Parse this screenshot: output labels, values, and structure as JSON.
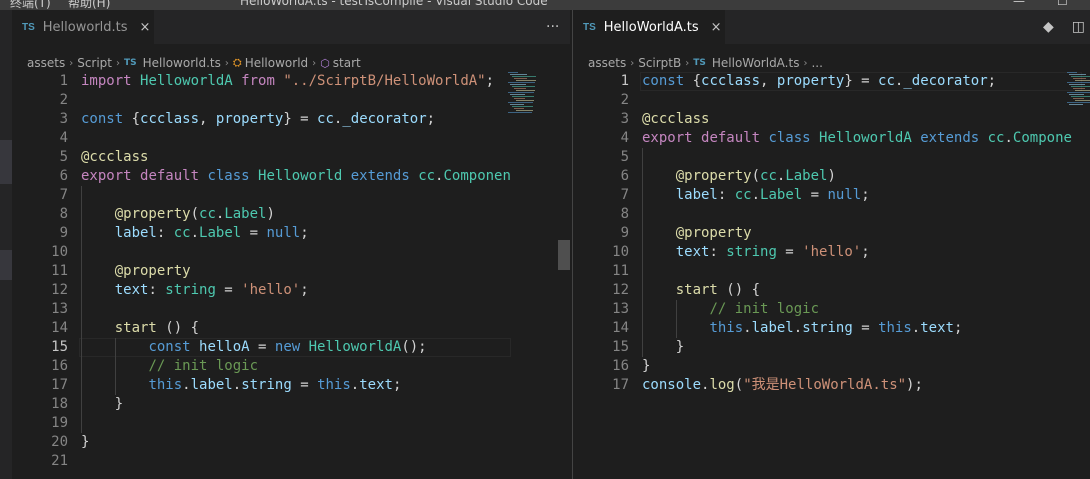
{
  "window": {
    "menu_terminal": "终端(T)",
    "menu_help": "帮助(H)",
    "title": "HelloWorldA.ts - testTsComplie - Visual Studio Code"
  },
  "colors": {
    "background": "#1e1e1e",
    "keyword": "#569cd6",
    "control": "#c586c0",
    "string": "#ce9178",
    "variable": "#9cdcfe",
    "type": "#4ec9b0",
    "function": "#dcdcaa",
    "comment": "#6a9955",
    "ts_badge": "#519aba"
  },
  "left": {
    "tab": {
      "badge": "TS",
      "label": "Helloworld.ts",
      "close": "×"
    },
    "more_actions": "···",
    "breadcrumb": [
      "assets",
      "Script",
      "Helloworld.ts",
      "Helloworld",
      "start"
    ],
    "current_line": 15,
    "lines": [
      [
        [
          "kw2",
          "import "
        ],
        [
          "cls",
          "HelloworldA"
        ],
        [
          "kw2",
          " from "
        ],
        [
          "str",
          "\"../ScirptB/HelloWorldA\""
        ],
        [
          "pl",
          ";"
        ]
      ],
      [],
      [
        [
          "kw",
          "const "
        ],
        [
          "pl",
          "{"
        ],
        [
          "var",
          "ccclass"
        ],
        [
          "pl",
          ", "
        ],
        [
          "var",
          "property"
        ],
        [
          "pl",
          "} = "
        ],
        [
          "var",
          "cc"
        ],
        [
          "pl",
          "."
        ],
        [
          "var",
          "_decorator"
        ],
        [
          "pl",
          ";"
        ]
      ],
      [],
      [
        [
          "fn",
          "@ccclass"
        ]
      ],
      [
        [
          "kw2",
          "export "
        ],
        [
          "kw2",
          "default "
        ],
        [
          "kw",
          "class "
        ],
        [
          "cls",
          "Helloworld "
        ],
        [
          "kw",
          "extends "
        ],
        [
          "cls",
          "cc"
        ],
        [
          "pl",
          "."
        ],
        [
          "cls",
          "Componen"
        ]
      ],
      [],
      [
        [
          "pl",
          "    "
        ],
        [
          "fn",
          "@property"
        ],
        [
          "pl",
          "("
        ],
        [
          "cls",
          "cc"
        ],
        [
          "pl",
          "."
        ],
        [
          "cls",
          "Label"
        ],
        [
          "pl",
          ")"
        ]
      ],
      [
        [
          "pl",
          "    "
        ],
        [
          "var",
          "label"
        ],
        [
          "pl",
          ": "
        ],
        [
          "cls",
          "cc"
        ],
        [
          "pl",
          "."
        ],
        [
          "cls",
          "Label"
        ],
        [
          "pl",
          " = "
        ],
        [
          "kw",
          "null"
        ],
        [
          "pl",
          ";"
        ]
      ],
      [],
      [
        [
          "pl",
          "    "
        ],
        [
          "fn",
          "@property"
        ]
      ],
      [
        [
          "pl",
          "    "
        ],
        [
          "var",
          "text"
        ],
        [
          "pl",
          ": "
        ],
        [
          "cls",
          "string"
        ],
        [
          "pl",
          " = "
        ],
        [
          "str",
          "'hello'"
        ],
        [
          "pl",
          ";"
        ]
      ],
      [],
      [
        [
          "pl",
          "    "
        ],
        [
          "fn",
          "start"
        ],
        [
          "pl",
          " () {"
        ]
      ],
      [
        [
          "pl",
          "        "
        ],
        [
          "kw",
          "const "
        ],
        [
          "var",
          "helloA"
        ],
        [
          "pl",
          " = "
        ],
        [
          "kw",
          "new "
        ],
        [
          "cls",
          "HelloworldA"
        ],
        [
          "pl",
          "();"
        ]
      ],
      [
        [
          "pl",
          "        "
        ],
        [
          "cm",
          "// init logic"
        ]
      ],
      [
        [
          "pl",
          "        "
        ],
        [
          "kw",
          "this"
        ],
        [
          "pl",
          "."
        ],
        [
          "var",
          "label"
        ],
        [
          "pl",
          "."
        ],
        [
          "var",
          "string"
        ],
        [
          "pl",
          " = "
        ],
        [
          "kw",
          "this"
        ],
        [
          "pl",
          "."
        ],
        [
          "var",
          "text"
        ],
        [
          "pl",
          ";"
        ]
      ],
      [
        [
          "pl",
          "    }"
        ]
      ],
      [],
      [
        [
          "pl",
          "}"
        ]
      ],
      []
    ]
  },
  "right": {
    "tab": {
      "badge": "TS",
      "label": "HelloWorldA.ts",
      "close": "×"
    },
    "breadcrumb": [
      "assets",
      "ScirptB",
      "HelloWorldA.ts",
      "..."
    ],
    "current_line": 1,
    "lines": [
      [
        [
          "kw",
          "const "
        ],
        [
          "pl",
          "{"
        ],
        [
          "var",
          "ccclass"
        ],
        [
          "pl",
          ", "
        ],
        [
          "var",
          "property"
        ],
        [
          "pl",
          "} = "
        ],
        [
          "var",
          "cc"
        ],
        [
          "pl",
          "."
        ],
        [
          "var",
          "_decorator"
        ],
        [
          "pl",
          ";"
        ]
      ],
      [],
      [
        [
          "fn",
          "@ccclass"
        ]
      ],
      [
        [
          "kw2",
          "export "
        ],
        [
          "kw2",
          "default "
        ],
        [
          "kw",
          "class "
        ],
        [
          "cls",
          "HelloworldA "
        ],
        [
          "kw",
          "extends "
        ],
        [
          "cls",
          "cc"
        ],
        [
          "pl",
          "."
        ],
        [
          "cls",
          "Compone"
        ]
      ],
      [],
      [
        [
          "pl",
          "    "
        ],
        [
          "fn",
          "@property"
        ],
        [
          "pl",
          "("
        ],
        [
          "cls",
          "cc"
        ],
        [
          "pl",
          "."
        ],
        [
          "cls",
          "Label"
        ],
        [
          "pl",
          ")"
        ]
      ],
      [
        [
          "pl",
          "    "
        ],
        [
          "var",
          "label"
        ],
        [
          "pl",
          ": "
        ],
        [
          "cls",
          "cc"
        ],
        [
          "pl",
          "."
        ],
        [
          "cls",
          "Label"
        ],
        [
          "pl",
          " = "
        ],
        [
          "kw",
          "null"
        ],
        [
          "pl",
          ";"
        ]
      ],
      [],
      [
        [
          "pl",
          "    "
        ],
        [
          "fn",
          "@property"
        ]
      ],
      [
        [
          "pl",
          "    "
        ],
        [
          "var",
          "text"
        ],
        [
          "pl",
          ": "
        ],
        [
          "cls",
          "string"
        ],
        [
          "pl",
          " = "
        ],
        [
          "str",
          "'hello'"
        ],
        [
          "pl",
          ";"
        ]
      ],
      [],
      [
        [
          "pl",
          "    "
        ],
        [
          "fn",
          "start"
        ],
        [
          "pl",
          " () {"
        ]
      ],
      [
        [
          "pl",
          "        "
        ],
        [
          "cm",
          "// init logic"
        ]
      ],
      [
        [
          "pl",
          "        "
        ],
        [
          "kw",
          "this"
        ],
        [
          "pl",
          "."
        ],
        [
          "var",
          "label"
        ],
        [
          "pl",
          "."
        ],
        [
          "var",
          "string"
        ],
        [
          "pl",
          " = "
        ],
        [
          "kw",
          "this"
        ],
        [
          "pl",
          "."
        ],
        [
          "var",
          "text"
        ],
        [
          "pl",
          ";"
        ]
      ],
      [
        [
          "pl",
          "    }"
        ]
      ],
      [
        [
          "pl",
          "}"
        ]
      ],
      [
        [
          "var",
          "console"
        ],
        [
          "pl",
          "."
        ],
        [
          "fn",
          "log"
        ],
        [
          "pl",
          "("
        ],
        [
          "str",
          "\"我是HelloWorldA.ts\""
        ],
        [
          "pl",
          ");"
        ]
      ]
    ]
  }
}
